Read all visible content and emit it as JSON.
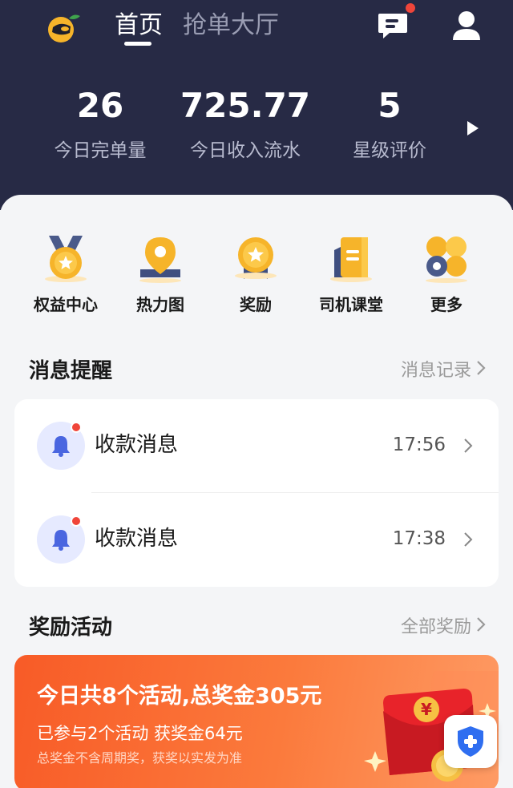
{
  "header": {
    "tabs": [
      {
        "label": "首页",
        "active": true
      },
      {
        "label": "抢单大厅",
        "active": false
      }
    ],
    "icons": [
      "orange-logo-icon",
      "message-icon",
      "user-icon"
    ]
  },
  "stats": [
    {
      "value": "26",
      "label": "今日完单量"
    },
    {
      "value": "725.77",
      "label": "今日收入流水"
    },
    {
      "value": "5",
      "label": "星级评价"
    }
  ],
  "quick_actions": [
    {
      "label": "权益中心",
      "icon": "medal-icon"
    },
    {
      "label": "热力图",
      "icon": "map-pin-icon"
    },
    {
      "label": "奖励",
      "icon": "award-icon"
    },
    {
      "label": "司机课堂",
      "icon": "book-icon"
    },
    {
      "label": "更多",
      "icon": "more-icon"
    }
  ],
  "messages": {
    "title": "消息提醒",
    "link": "消息记录",
    "items": [
      {
        "title": "收款消息",
        "time": "17:56",
        "unread": true
      },
      {
        "title": "收款消息",
        "time": "17:38",
        "unread": true
      }
    ]
  },
  "rewards": {
    "title": "奖励活动",
    "link": "全部奖励",
    "banner": {
      "title": "今日共8个活动,总奖金305元",
      "subtitle": "已参与2个活动 获奖金64元",
      "note": "总奖金不含周期奖，获奖以实发为准"
    }
  },
  "colors": {
    "header_bg": "#272a45",
    "accent": "#f0453a",
    "brand_yellow": "#f6b42a",
    "promo_orange": "#f85b27"
  }
}
